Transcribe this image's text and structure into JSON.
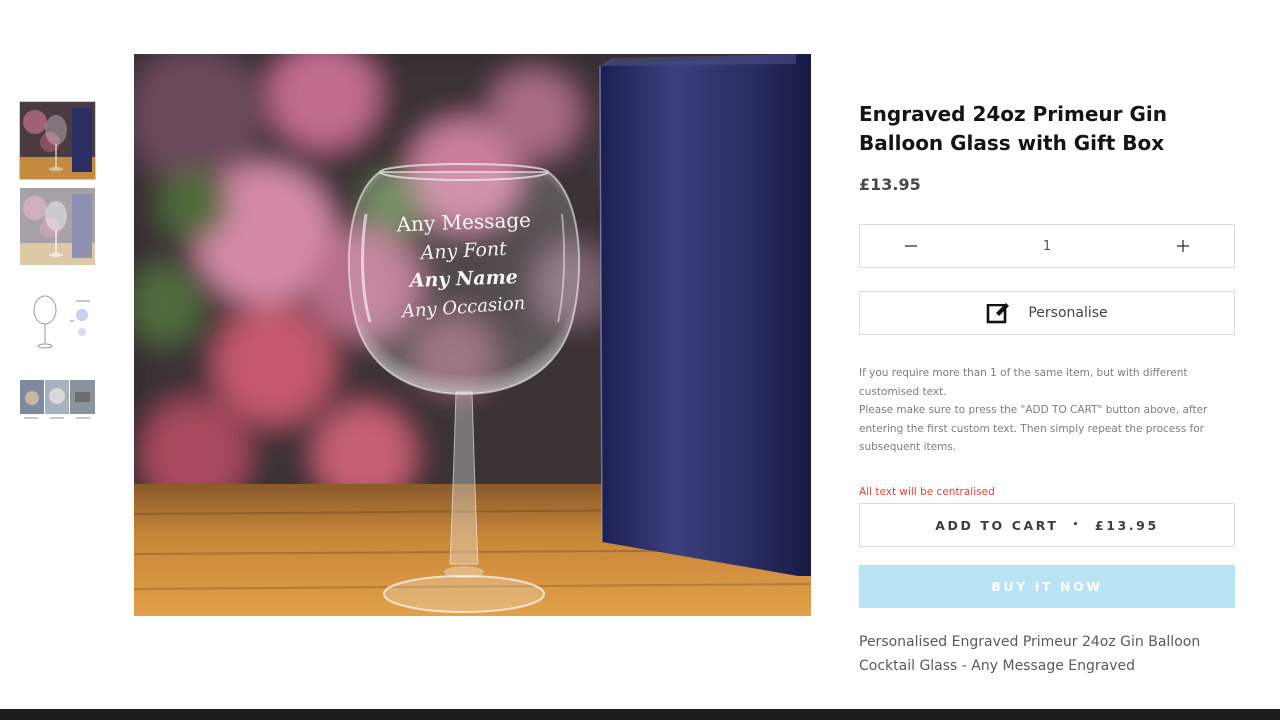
{
  "product": {
    "title": "Engraved 24oz Primeur Gin Balloon Glass with Gift Box",
    "price": "£13.95",
    "quantity": "1",
    "personalise_label": "Personalise",
    "note_line1": "If you require more than 1 of the same item, but with different customised text.",
    "note_line2": "Please make sure to press the \"ADD TO CART\" button above, after entering the first custom text. Then simply repeat the process for subsequent items.",
    "centred_note": "All text will be centralised",
    "add_to_cart_label": "ADD TO CART",
    "add_to_cart_separator": "•",
    "add_to_cart_price": "£13.95",
    "buy_now_label": "BUY IT NOW",
    "description": "Personalised Engraved Primeur 24oz Gin Balloon Cocktail Glass - Any Message Engraved"
  },
  "engraving": {
    "line1": "Any Message",
    "line2": "Any Font",
    "line3": "Any Name",
    "line4": "Any Occasion"
  },
  "icons": {
    "minus": "minus-icon",
    "plus": "plus-icon",
    "personalise": "edit-pencil-icon"
  },
  "colors": {
    "buy_now_bg": "#b9e3f2",
    "notice_red": "#e8413a",
    "gift_box": "#2b2f63"
  }
}
